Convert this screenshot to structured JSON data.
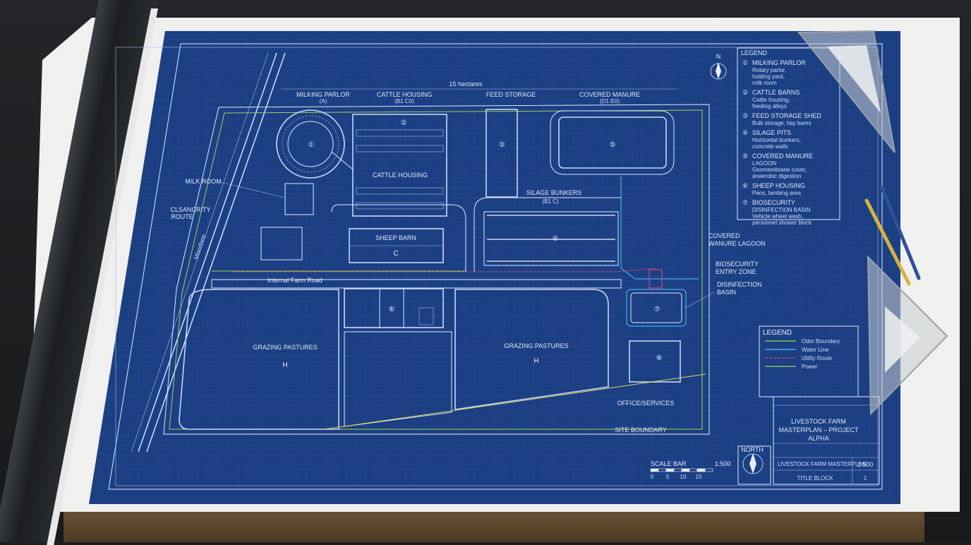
{
  "plan": {
    "dimension": "15 hectares",
    "north_small": "N",
    "north": "NORTH",
    "scale_bar_label": "SCALE BAR",
    "scale": "1:500",
    "scale_ticks": [
      "0",
      "5",
      "10",
      "15"
    ],
    "top_labels": {
      "milking_parlor": "MILKING PARLOR",
      "cattle_housing": "CATTLE HOUSING",
      "feed_storage": "FEED STORAGE",
      "covered_manure": "COVERED MANURE"
    },
    "sub_top": {
      "milking_parlor": "(A)",
      "cattle_housing": "(B1 C0)",
      "covered_manure": "(D1-E0)"
    },
    "site_labels": {
      "milk_room": "MILK ROOM",
      "biosecurity_route_1": "CLSANCRITY",
      "biosecurity_route_2": "ROUTE",
      "road_vertical": "Mlandlane",
      "cattle_housing": "CATTLE HOUSING",
      "silage_bunkers": "SILAGE BUNKERS",
      "silage_sub": "(B1 C)",
      "sheep_barn": "SHEEP BARN",
      "internal_road": "Internal Farm Road",
      "covered_lagoon_1": "COVERED",
      "covered_lagoon_2": "WANURE LAGOON",
      "biosecurity_1": "BIOSECURITY",
      "biosecurity_2": "ENTRY ZONE",
      "disinfection_1": "DISINFECTION",
      "disinfection_2": "BASIN",
      "grazing_left": "GRAZING PASTURES",
      "grazing_right": "GRAZING PASTURES",
      "office": "OFFICE/SERVICES",
      "site_boundary": "SITE BOUNDARY"
    },
    "markers": {
      "parlor": "①",
      "cattle": "②",
      "feed": "③",
      "silage": "④",
      "lagoon": "⑤",
      "sheep_barn": "C",
      "sheep_housing": "⑥",
      "basin": "⑦",
      "office": "⑧",
      "pasture_left": "H",
      "pasture_right": "H"
    },
    "legend_top": {
      "title": "LEGEND",
      "items": [
        {
          "num": "①",
          "title": "MILKING PARLOR",
          "lines": [
            "Rotary parlor,",
            "holding yard,",
            "milk room"
          ]
        },
        {
          "num": "②",
          "title": "CATTLE BARNS",
          "lines": [
            "Cattle housing,",
            "feeding alleys"
          ]
        },
        {
          "num": "③",
          "title": "FEED STORAGE SHED",
          "lines": [
            "Bulk storage, hay bams"
          ]
        },
        {
          "num": "④",
          "title": "SILAGE PITS",
          "lines": [
            "Horizontal bunkers,",
            "concrete walls"
          ]
        },
        {
          "num": "⑤",
          "title": "COVERED MANURE",
          "lines": [
            "LAGOON",
            "Geomembrane cover,",
            "anaerobic digestion"
          ]
        },
        {
          "num": "⑥",
          "title": "SHEEP HOUSING",
          "lines": [
            "Pens, lambing area"
          ]
        },
        {
          "num": "⑦",
          "title": "BIOSECURITY",
          "lines": [
            "DISINFECTION BASIN",
            "Vehicle wheel wash,",
            "personnel shower block"
          ]
        }
      ]
    },
    "legend_lines": {
      "title": "LEGEND",
      "items": [
        {
          "label": "Odor Boundary",
          "color": "#9bd35a"
        },
        {
          "label": "Water Line",
          "color": "#4fc4ff"
        },
        {
          "label": "Utility Route",
          "color": "#d04a7a"
        },
        {
          "label": "Power",
          "color": "#9bd35a"
        }
      ]
    },
    "title_block": {
      "title_1": "LIVESTOCK FARM",
      "title_2": "MASTERPLAN – PROJECT",
      "title_3": "ALPHA",
      "project": "LIVESTOCK FARM MASTERPLAN",
      "scale": "1:500",
      "label": "TITLE BLOCK",
      "sheet": "1"
    }
  }
}
